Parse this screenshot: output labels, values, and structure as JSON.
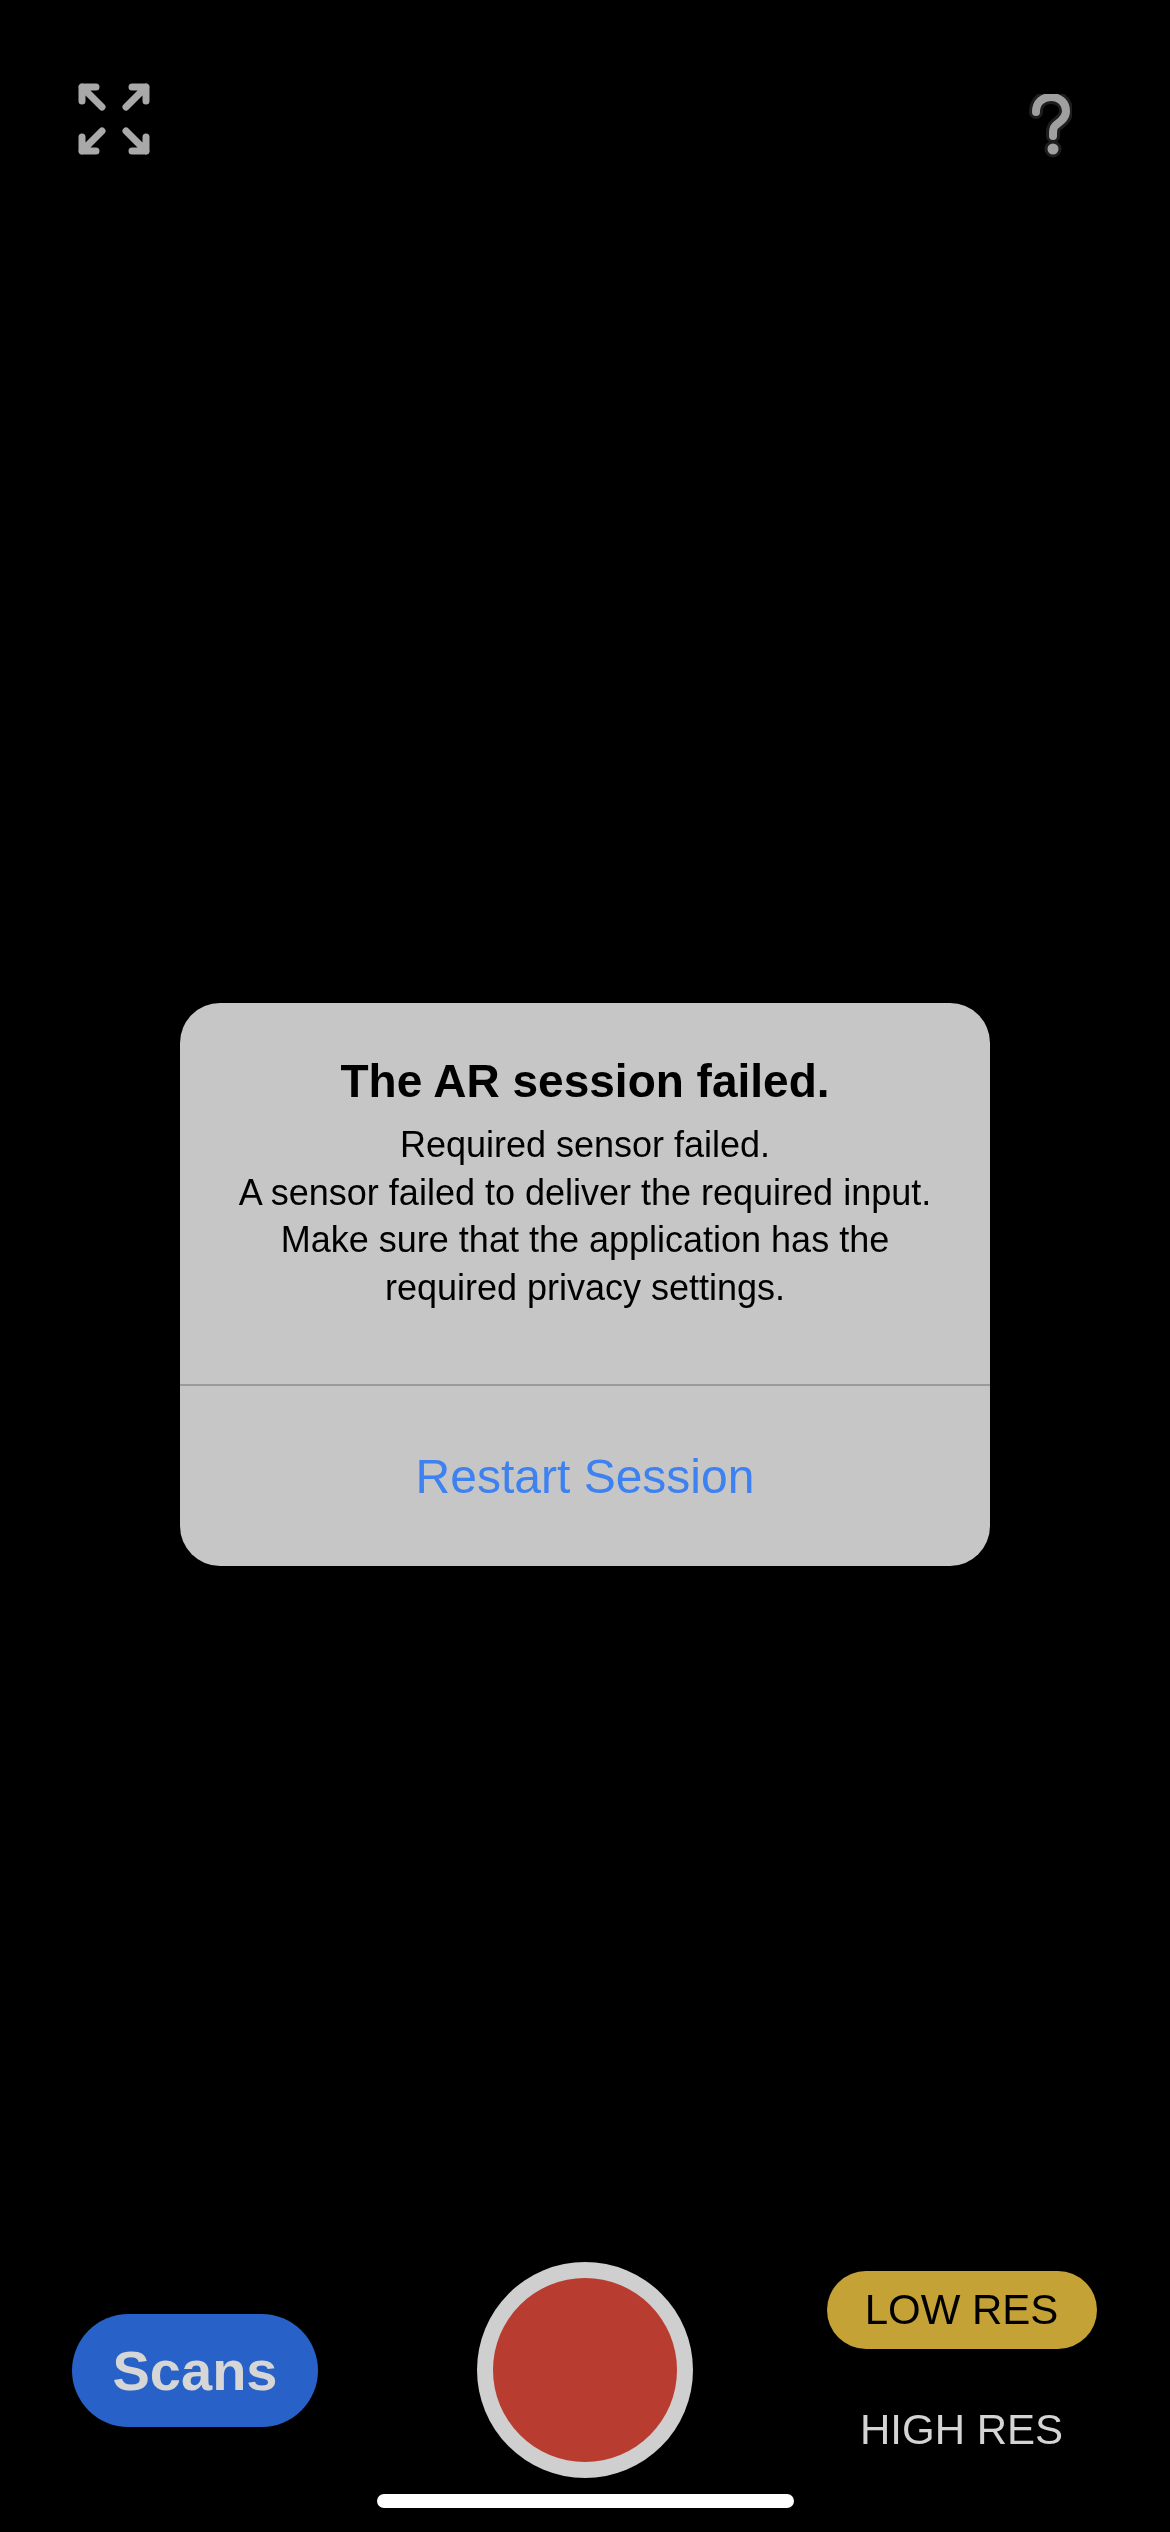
{
  "alert": {
    "title": "The AR session failed.",
    "message": "Required sensor failed.\nA sensor failed to deliver the required input.\nMake sure that the application has the required privacy settings.",
    "action": "Restart Session"
  },
  "scans_button": "Scans",
  "resolutions": [
    {
      "label": "LOW RES",
      "selected": true
    },
    {
      "label": "HIGH RES",
      "selected": false
    }
  ]
}
